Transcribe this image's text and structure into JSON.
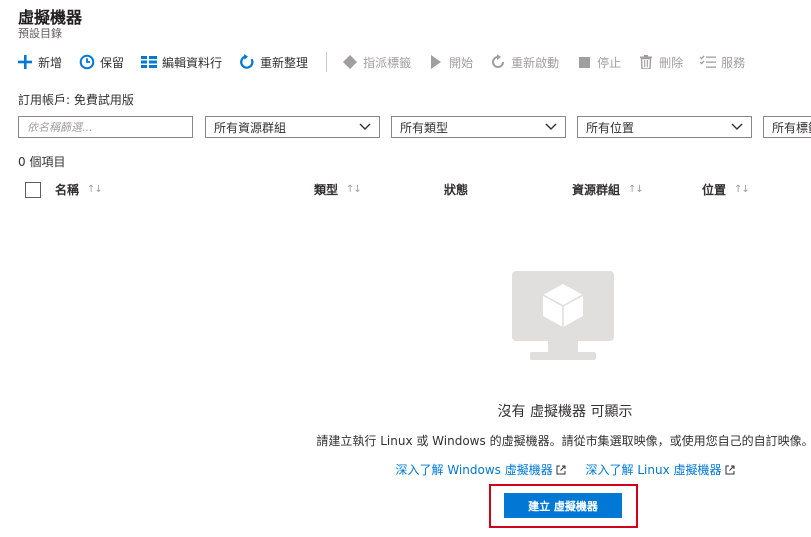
{
  "page": {
    "title": "虛擬機器",
    "subtitle": "預設目錄"
  },
  "toolbar": {
    "add": "新增",
    "reserve": "保留",
    "edit_columns": "編輯資料行",
    "refresh": "重新整理",
    "assign_tags": "指派標籤",
    "start": "開始",
    "restart": "重新啟動",
    "stop": "停止",
    "delete": "刪除",
    "services": "服務"
  },
  "subscription": {
    "label": "訂用帳戶: 免費試用版"
  },
  "filters": {
    "name_placeholder": "依名稱篩選...",
    "resource_group": "所有資源群組",
    "type": "所有類型",
    "location": "所有位置",
    "tags": "所有標籤"
  },
  "list": {
    "count": "0 個項目",
    "columns": {
      "name": "名稱",
      "type": "類型",
      "status": "狀態",
      "resource_group": "資源群組",
      "location": "位置"
    }
  },
  "empty_state": {
    "title": "沒有 虛擬機器 可顯示",
    "description": "請建立執行 Linux 或 Windows 的虛擬機器。請從市集選取映像，或使用您自己的自訂映像。",
    "link_windows": "深入了解 Windows 虛擬機器",
    "link_linux": "深入了解 Linux 虛擬機器",
    "create_button": "建立 虛擬機器"
  },
  "colors": {
    "accent": "#0078d4",
    "highlight_outline": "#d0021b",
    "disabled": "#a19f9d"
  }
}
